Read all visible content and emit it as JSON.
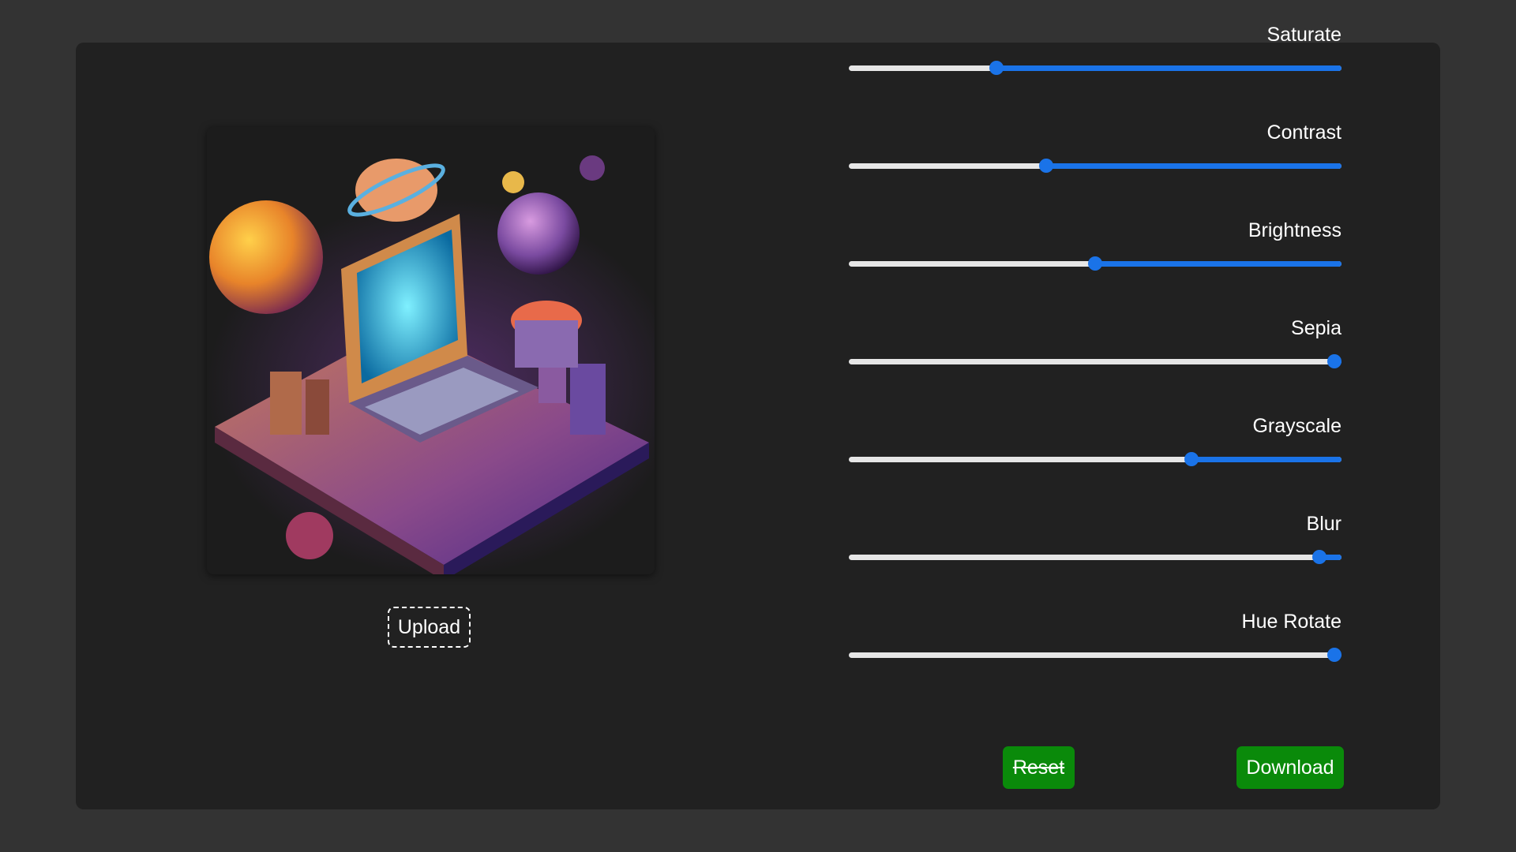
{
  "editor": {
    "upload_label": "Upload",
    "reset_label": "Reset",
    "download_label": "Download",
    "accent_color": "#1a73e8",
    "button_color": "#0a8a0a"
  },
  "filters": [
    {
      "label": "Saturate",
      "value": 0.3
    },
    {
      "label": "Contrast",
      "value": 0.4
    },
    {
      "label": "Brightness",
      "value": 0.5
    },
    {
      "label": "Sepia",
      "value": 0.985
    },
    {
      "label": "Grayscale",
      "value": 0.695
    },
    {
      "label": "Blur",
      "value": 0.955
    },
    {
      "label": "Hue Rotate",
      "value": 0.985
    }
  ],
  "preview_image": {
    "description_icon": "isometric-computer-planets-image"
  }
}
